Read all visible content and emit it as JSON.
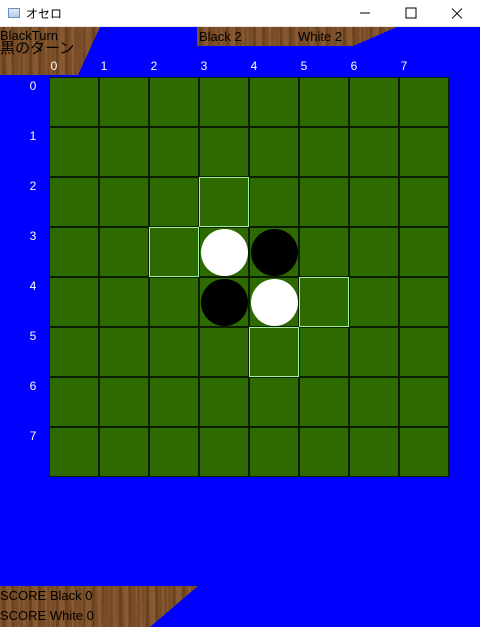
{
  "window": {
    "title": "オセロ",
    "icon": "app-icon",
    "controls": [
      "minimize-icon",
      "maximize-icon",
      "close-icon"
    ]
  },
  "status": {
    "turn": "BlackTurn",
    "turn_jp": "黒のターン",
    "black_count": "Black 2",
    "white_count": "White 2"
  },
  "columns": [
    "0",
    "1",
    "2",
    "3",
    "4",
    "5",
    "6",
    "7"
  ],
  "rows": [
    "0",
    "1",
    "2",
    "3",
    "4",
    "5",
    "6",
    "7"
  ],
  "board": {
    "discs": [
      {
        "row": 3,
        "col": 3,
        "color": "white"
      },
      {
        "row": 3,
        "col": 4,
        "color": "black"
      },
      {
        "row": 4,
        "col": 3,
        "color": "black"
      },
      {
        "row": 4,
        "col": 4,
        "color": "white"
      }
    ],
    "valid_moves": [
      {
        "row": 2,
        "col": 3
      },
      {
        "row": 3,
        "col": 2
      },
      {
        "row": 4,
        "col": 5
      },
      {
        "row": 5,
        "col": 4
      }
    ]
  },
  "score": {
    "black": "SCORE Black 0",
    "white": "SCORE White 0"
  },
  "colors": {
    "background": "#0000ff",
    "board": "#2d6a00",
    "grid_line": "#0b1d00",
    "hint_border": "#9cf29c",
    "panel_wood": "#7a4a22"
  }
}
